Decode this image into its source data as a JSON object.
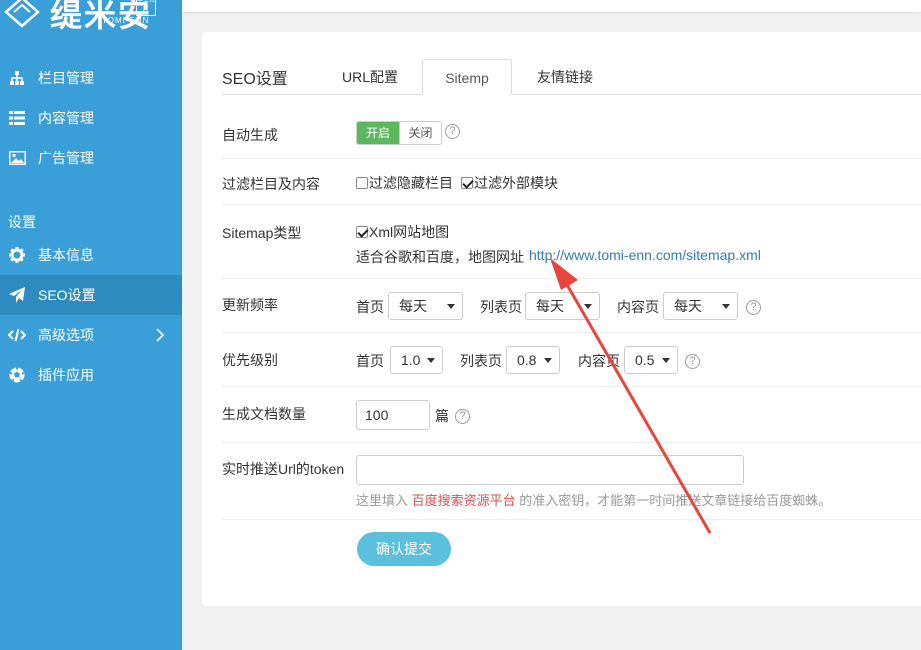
{
  "sidebar": {
    "logo_cn": "缇米安",
    "logo_en": "TOMI-ENN",
    "logo_stamp": "手工社区",
    "items": [
      {
        "label": "栏目管理",
        "icon": "sitemap-icon"
      },
      {
        "label": "内容管理",
        "icon": "list-icon"
      },
      {
        "label": "广告管理",
        "icon": "image-icon"
      }
    ],
    "section_label": "设置",
    "settings_items": [
      {
        "label": "基本信息",
        "icon": "gear-icon"
      },
      {
        "label": "SEO设置",
        "icon": "paper-plane-icon",
        "active": true
      },
      {
        "label": "高级选项",
        "icon": "code-icon"
      },
      {
        "label": "插件应用",
        "icon": "soccer-ball-icon"
      }
    ]
  },
  "page": {
    "title": "SEO设置",
    "tabs": [
      "URL配置",
      "Sitemp",
      "友情链接"
    ],
    "active_tab": "Sitemp"
  },
  "form": {
    "auto_generate": {
      "label": "自动生成",
      "on_label": "开启",
      "off_label": "关闭",
      "value": "开启"
    },
    "filter": {
      "label": "过滤栏目及内容",
      "opt1": "过滤隐藏栏目",
      "opt1_checked": false,
      "opt2": "过滤外部模块",
      "opt2_checked": true
    },
    "sitemap_type": {
      "label": "Sitemap类型",
      "opt": "Xml网站地图",
      "opt_checked": true,
      "desc": "适合谷歌和百度，地图网址",
      "url": "http://www.tomi-enn.com/sitemap.xml"
    },
    "update_freq": {
      "label": "更新频率",
      "home_label": "首页",
      "home": "每天",
      "list_label": "列表页",
      "list": "每天",
      "content_label": "内容页",
      "content": "每天"
    },
    "priority": {
      "label": "优先级别",
      "home_label": "首页",
      "home": "1.0",
      "list_label": "列表页",
      "list": "0.8",
      "content_label": "内容页",
      "content": "0.5"
    },
    "doc_count": {
      "label": "生成文档数量",
      "value": "100",
      "unit": "篇"
    },
    "push_token": {
      "label": "实时推送Url的token",
      "value": "",
      "hint_pre": "这里填入",
      "hint_link": "百度搜索资源平台",
      "hint_post": "的准入密钥，才能第一时间推送文章链接给百度蜘蛛。"
    },
    "submit_label": "确认提交"
  },
  "colors": {
    "sidebar_bg": "#3a9fd8",
    "sidebar_active": "#2d8bc0",
    "toggle_on": "#5cb85c",
    "submit_btn": "#5bc0de",
    "link": "#337ab7",
    "hint_red": "#d9534f",
    "annotation_arrow": "#e8453c"
  }
}
